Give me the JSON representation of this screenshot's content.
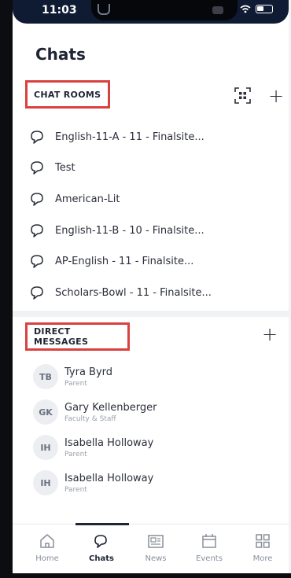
{
  "status_bar": {
    "time": "11:03"
  },
  "page": {
    "title": "Chats"
  },
  "chat_rooms": {
    "header": "CHAT ROOMS",
    "items": [
      {
        "label": "English-11-A - 11 - Finalsite..."
      },
      {
        "label": "Test"
      },
      {
        "label": "American-Lit"
      },
      {
        "label": "English-11-B - 10 - Finalsite..."
      },
      {
        "label": "AP-English - 11 - Finalsite..."
      },
      {
        "label": "Scholars-Bowl - 11 - Finalsite..."
      }
    ]
  },
  "direct_messages": {
    "header": "DIRECT MESSAGES",
    "items": [
      {
        "initials": "TB",
        "name": "Tyra Byrd",
        "role": "Parent"
      },
      {
        "initials": "GK",
        "name": "Gary Kellenberger",
        "role": "Faculty & Staff"
      },
      {
        "initials": "IH",
        "name": "Isabella Holloway",
        "role": "Parent"
      },
      {
        "initials": "IH",
        "name": "Isabella Holloway",
        "role": "Parent"
      }
    ]
  },
  "tab_bar": {
    "active": "Chats",
    "tabs": [
      {
        "label": "Home",
        "icon": "home-icon"
      },
      {
        "label": "Chats",
        "icon": "chat-icon"
      },
      {
        "label": "News",
        "icon": "news-icon"
      },
      {
        "label": "Events",
        "icon": "calendar-icon"
      },
      {
        "label": "More",
        "icon": "grid-icon"
      }
    ]
  },
  "colors": {
    "highlight": "#d9413f",
    "status_bar": "#0f1b33",
    "text": "#2b2f3a"
  }
}
